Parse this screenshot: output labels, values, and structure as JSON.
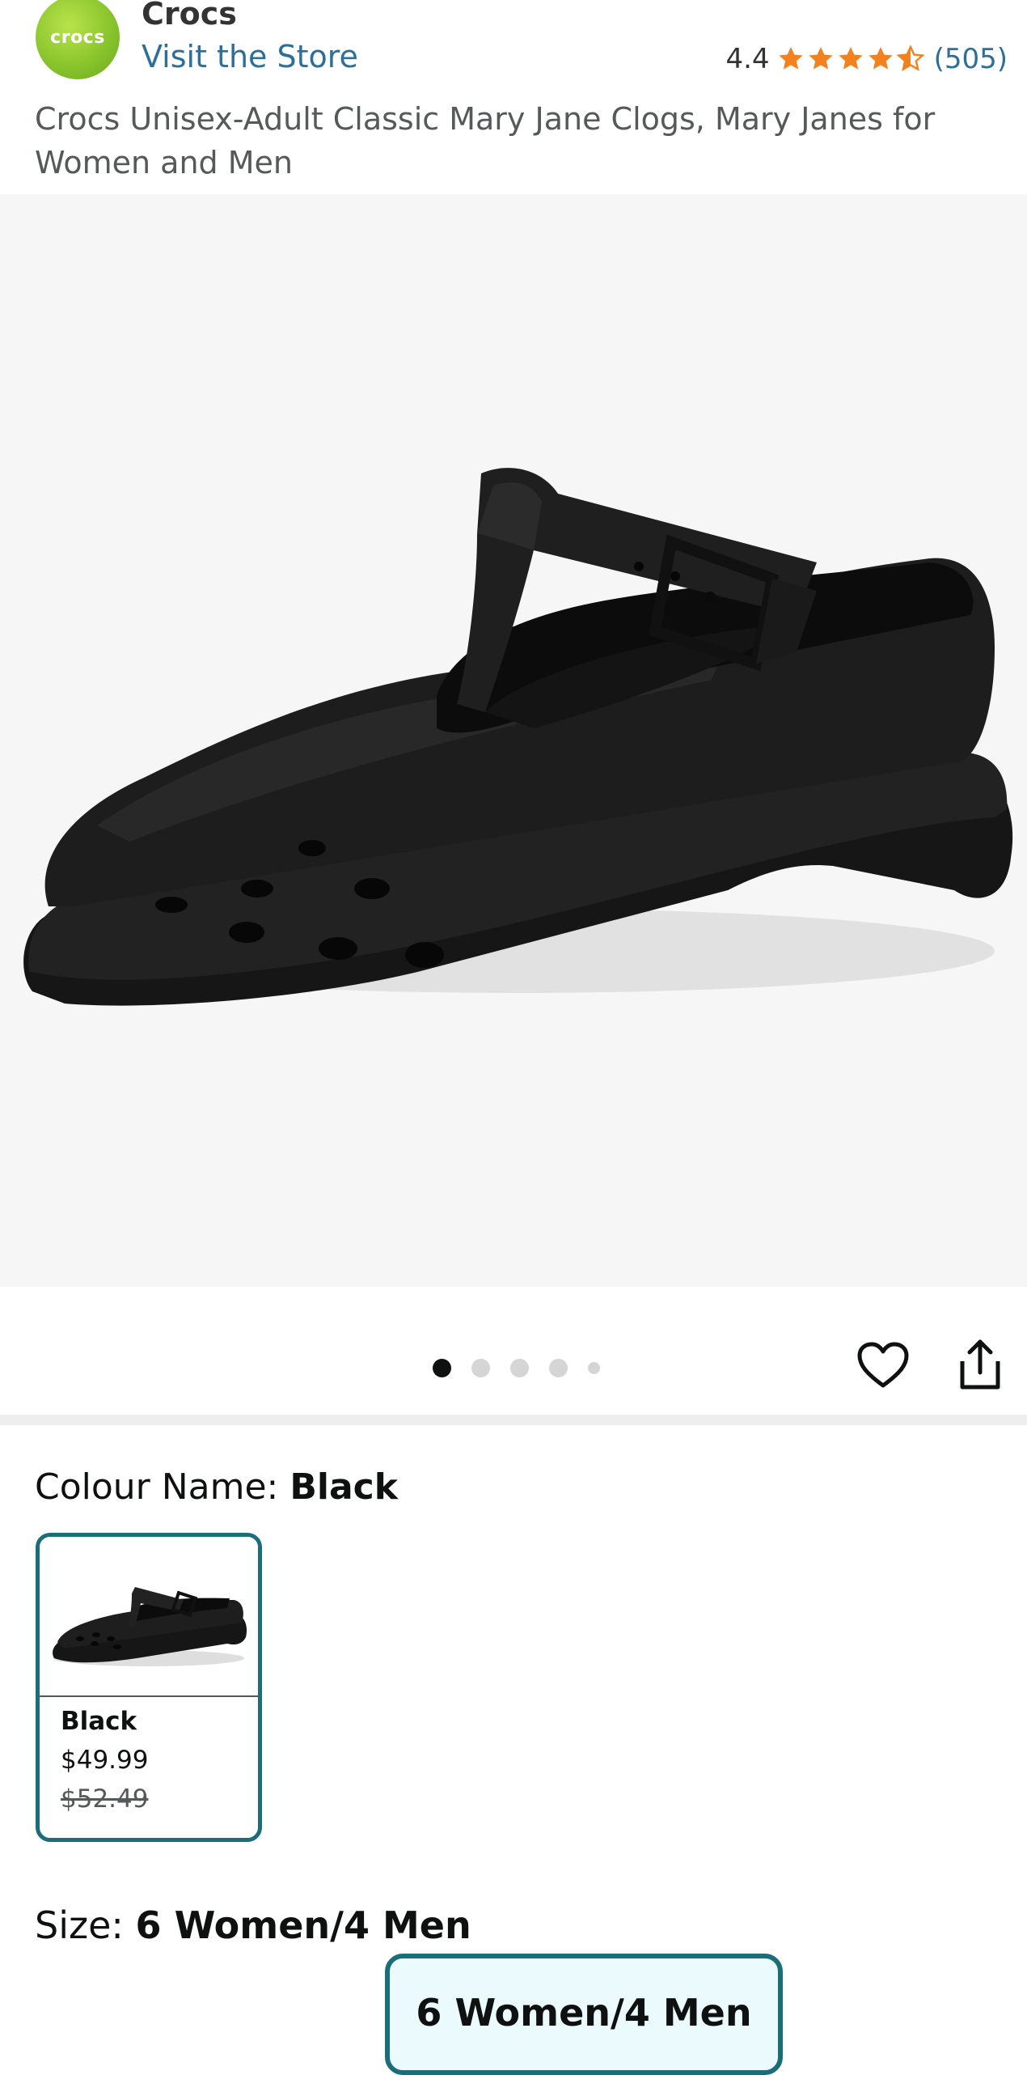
{
  "brand": {
    "logo_text": "crocs",
    "name": "Crocs",
    "store_link": "Visit the Store"
  },
  "rating": {
    "value": "4.4",
    "stars": 4.4,
    "count": "(505)",
    "star_color": "#f3821e"
  },
  "product": {
    "title": "Crocs Unisex-Adult Classic Mary Jane Clogs, Mary Janes for Women and Men"
  },
  "gallery": {
    "image_icon": "black-mary-jane-clog-image",
    "pages": 5,
    "active_page": 1
  },
  "actions": {
    "wishlist_icon": "heart-icon",
    "share_icon": "share-icon"
  },
  "colour": {
    "label": "Colour Name: ",
    "selected": "Black",
    "options": [
      {
        "name": "Black",
        "price": "$49.99",
        "list_price": "$52.49"
      }
    ]
  },
  "size": {
    "label": "Size: ",
    "selected": "6 Women/4 Men",
    "options": [
      "6 Women/4 Men"
    ]
  },
  "colors": {
    "link": "#2d6f98",
    "selected_border": "#1c6d7a",
    "selected_bg": "#ebfafc",
    "logo": "#86c22b"
  }
}
